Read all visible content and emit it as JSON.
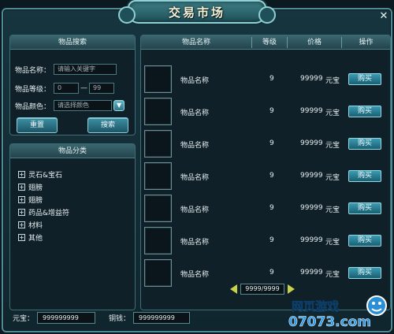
{
  "window": {
    "title": "交易市场",
    "close_glyph": "✕"
  },
  "search": {
    "header": "物品搜索",
    "name_label": "物品名称：",
    "name_placeholder": "请输入关键字",
    "level_label": "物品等级：",
    "level_min": "0",
    "level_dash": "—",
    "level_max": "99",
    "color_label": "物品颜色：",
    "color_placeholder": "请选择颜色",
    "reset_label": "重置",
    "search_label": "搜索"
  },
  "categories": {
    "header": "物品分类",
    "items": [
      {
        "label": "灵石&宝石"
      },
      {
        "label": "翅膀"
      },
      {
        "label": "翅膀"
      },
      {
        "label": "药品&增益符"
      },
      {
        "label": "材料"
      },
      {
        "label": "其他"
      }
    ]
  },
  "list": {
    "columns": [
      "物品名称",
      "等级",
      "价格",
      "操作"
    ],
    "rows": [
      {
        "name": "物品名称",
        "level": "9",
        "price": "99999",
        "currency": "元宝",
        "action": "购买"
      },
      {
        "name": "物品名称",
        "level": "9",
        "price": "99999",
        "currency": "元宝",
        "action": "购买"
      },
      {
        "name": "物品名称",
        "level": "9",
        "price": "99999",
        "currency": "元宝",
        "action": "购买"
      },
      {
        "name": "物品名称",
        "level": "9",
        "price": "99999",
        "currency": "元宝",
        "action": "购买"
      },
      {
        "name": "物品名称",
        "level": "9",
        "price": "99999",
        "currency": "元宝",
        "action": "购买"
      },
      {
        "name": "物品名称",
        "level": "9",
        "price": "99999",
        "currency": "元宝",
        "action": "购买"
      },
      {
        "name": "物品名称",
        "level": "9",
        "price": "99999",
        "currency": "元宝",
        "action": "购买"
      }
    ],
    "page": "9999/9999"
  },
  "wallet": {
    "yuanbao_label": "元宝：",
    "yuanbao_value": "999999999",
    "copper_label": "铜钱：",
    "copper_value": "999999999"
  },
  "watermark": {
    "line1": "网页游戏",
    "line2": "07073.com"
  },
  "colors": {
    "accent": "#3a9bb3",
    "frame": "#4f8a95",
    "page_arrow": "#c7d24a"
  }
}
